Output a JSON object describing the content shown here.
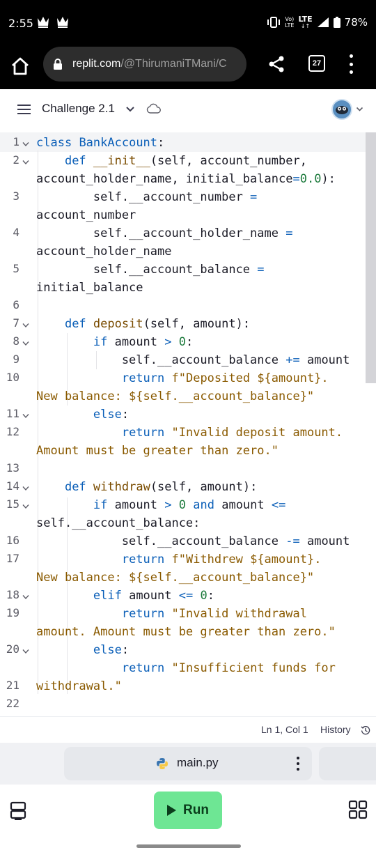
{
  "status_bar": {
    "time": "2:55",
    "network_top": "Vo)",
    "network_bottom": "LTE",
    "lte": "LTE",
    "battery": "78%"
  },
  "browser": {
    "url_host": "replit.com",
    "url_path": "/@ThirumaniTMani/C",
    "tab_count": "27"
  },
  "header": {
    "project_title": "Challenge 2.1"
  },
  "editor": {
    "lines": [
      {
        "n": "1",
        "fold": true
      },
      {
        "n": "2",
        "fold": true
      },
      {
        "n": "3",
        "fold": false
      },
      {
        "n": "4",
        "fold": false
      },
      {
        "n": "5",
        "fold": false
      },
      {
        "n": "6",
        "fold": false
      },
      {
        "n": "7",
        "fold": true
      },
      {
        "n": "8",
        "fold": true
      },
      {
        "n": "9",
        "fold": false
      },
      {
        "n": "10",
        "fold": false
      },
      {
        "n": "11",
        "fold": true
      },
      {
        "n": "12",
        "fold": false
      },
      {
        "n": "13",
        "fold": false
      },
      {
        "n": "14",
        "fold": true
      },
      {
        "n": "15",
        "fold": true
      },
      {
        "n": "16",
        "fold": false
      },
      {
        "n": "17",
        "fold": false
      },
      {
        "n": "18",
        "fold": true
      },
      {
        "n": "19",
        "fold": false
      },
      {
        "n": "20",
        "fold": true
      },
      {
        "n": "21",
        "fold": false
      },
      {
        "n": "22",
        "fold": false
      }
    ],
    "code": [
      "class BankAccount:",
      "    def __init__(self, account_number,",
      "account_holder_name, initial_balance=0.0):",
      "        self.__account_number =",
      "account_number",
      "        self.__account_holder_name =",
      "account_holder_name",
      "        self.__account_balance =",
      "initial_balance",
      "",
      "    def deposit(self, amount):",
      "        if amount > 0:",
      "            self.__account_balance += amount",
      "            return f\"Deposited ${amount}.",
      "New balance: ${self.__account_balance}\"",
      "        else:",
      "            return \"Invalid deposit amount.",
      "Amount must be greater than zero.\"",
      "",
      "    def withdraw(self, amount):",
      "        if amount > 0 and amount <=",
      "self.__account_balance:",
      "            self.__account_balance -= amount",
      "            return f\"Withdrew ${amount}.",
      "New balance: ${self.__account_balance}\"",
      "        elif amount <= 0:",
      "            return \"Invalid withdrawal",
      "amount. Amount must be greater than zero.\"",
      "        else:",
      "            return \"Insufficient funds for",
      "withdrawal.\"",
      ""
    ]
  },
  "editor_status": {
    "position": "Ln 1, Col 1",
    "history_label": "History"
  },
  "file_tab": {
    "name": "main.py"
  },
  "actions": {
    "run_label": "Run"
  },
  "colors": {
    "keyword": "#0b5fb8",
    "string": "#8a5a00",
    "number": "#1c7a3c",
    "run_button": "#6ee694"
  }
}
